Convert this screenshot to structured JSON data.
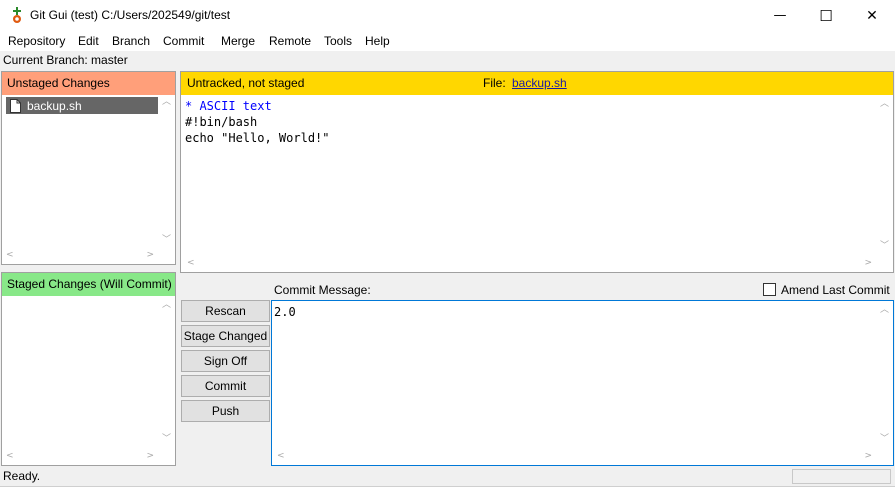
{
  "window": {
    "title": "Git Gui (test) C:/Users/202549/git/test",
    "minimize_glyph": "—",
    "maximize_glyph": "☐",
    "close_glyph": "✕"
  },
  "menu": [
    "Repository",
    "Edit",
    "Branch",
    "Commit",
    "Merge",
    "Remote",
    "Tools",
    "Help"
  ],
  "branch": {
    "text": "Current Branch: master"
  },
  "unstaged": {
    "header": "Unstaged Changes",
    "files": [
      "backup.sh"
    ]
  },
  "staged": {
    "header": "Staged Changes (Will Commit)",
    "files": []
  },
  "diff": {
    "status": "Untracked, not staged",
    "file_label": "File:",
    "file_name": "backup.sh",
    "lines": [
      "* ASCII text",
      "#!bin/bash",
      "echo \"Hello, World!\""
    ]
  },
  "commit": {
    "label": "Commit Message:",
    "amend_label": "Amend Last Commit",
    "amend_checked": false,
    "message": "2.0"
  },
  "buttons": {
    "rescan": "Rescan",
    "stage_changed": "Stage Changed",
    "sign_off": "Sign Off",
    "commit": "Commit",
    "push": "Push"
  },
  "status": {
    "text": "Ready."
  },
  "colors": {
    "unstaged_header": "#ff9f7a",
    "staged_header": "#88e888",
    "diff_header": "#ffd700",
    "selected_file": "#666666",
    "diff_info_text": "#0000ff"
  }
}
